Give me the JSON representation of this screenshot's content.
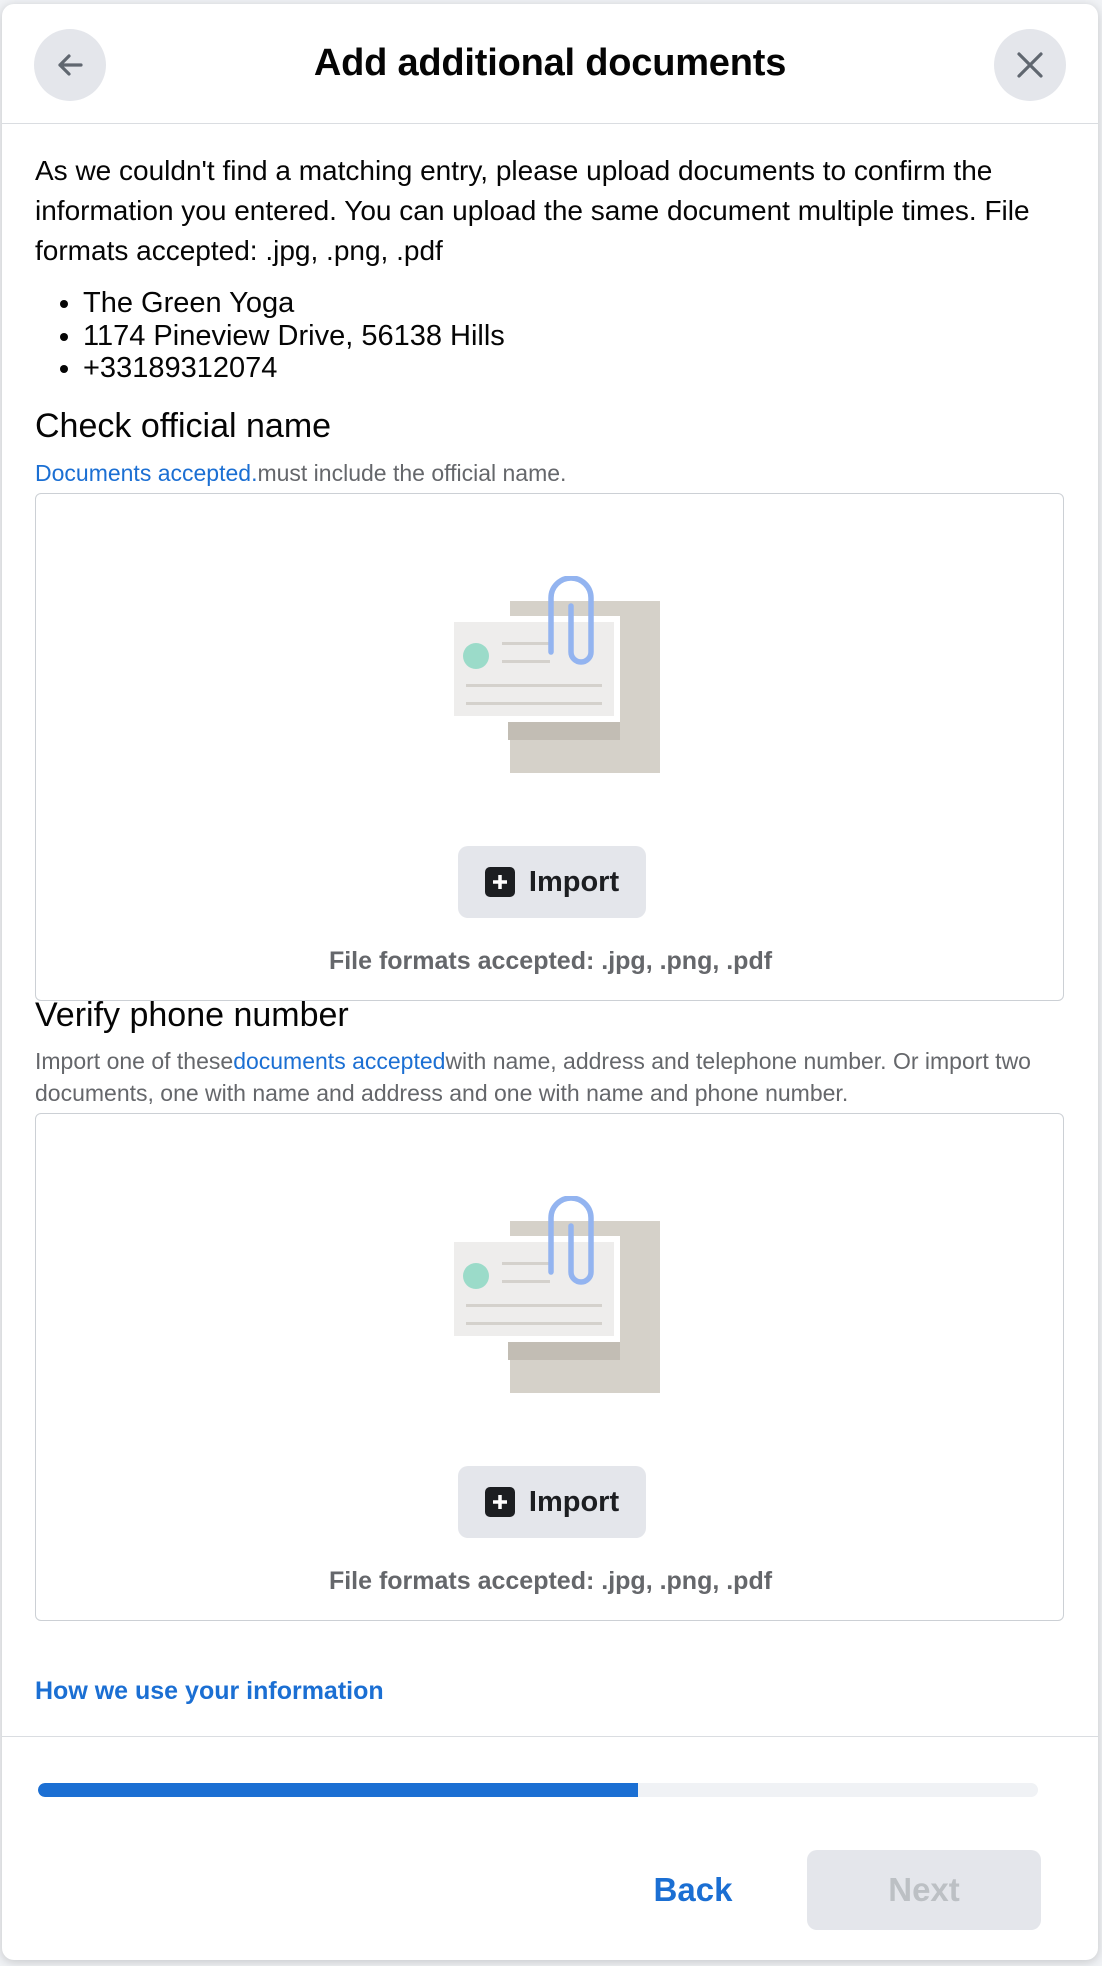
{
  "header": {
    "title": "Add additional documents",
    "back_icon": "arrow-left-icon",
    "close_icon": "close-icon"
  },
  "intro": {
    "text": "As we couldn't find a matching entry, please upload documents to confirm the information you entered. You can upload the same document multiple times. File formats accepted: .jpg, .png, .pdf",
    "items": [
      "The Green Yoga",
      "1174 Pineview Drive, 56138 Hills",
      "+33189312074"
    ]
  },
  "sections": [
    {
      "title": "Check official name",
      "desc_prefix": "",
      "desc_link": "Documents accepted.",
      "desc_suffix": "must include the official name.",
      "import_label": "Import",
      "formats": "File formats accepted: .jpg, .png, .pdf"
    },
    {
      "title": "Verify phone number",
      "desc_prefix": "Import one of these",
      "desc_link": "documents accepted",
      "desc_suffix": "with name, address and telephone number. Or import two documents, one with name and address and one with name and phone number.",
      "import_label": "Import",
      "formats": "File formats accepted: .jpg, .png, .pdf"
    }
  ],
  "info_link": "How we use your information",
  "footer": {
    "progress": 0.6,
    "back_label": "Back",
    "next_label": "Next"
  },
  "colors": {
    "accent": "#1b6fd3",
    "button_bg": "#e4e6eb",
    "disabled_text": "#bcc0c4",
    "secondary_text": "#65676b"
  }
}
